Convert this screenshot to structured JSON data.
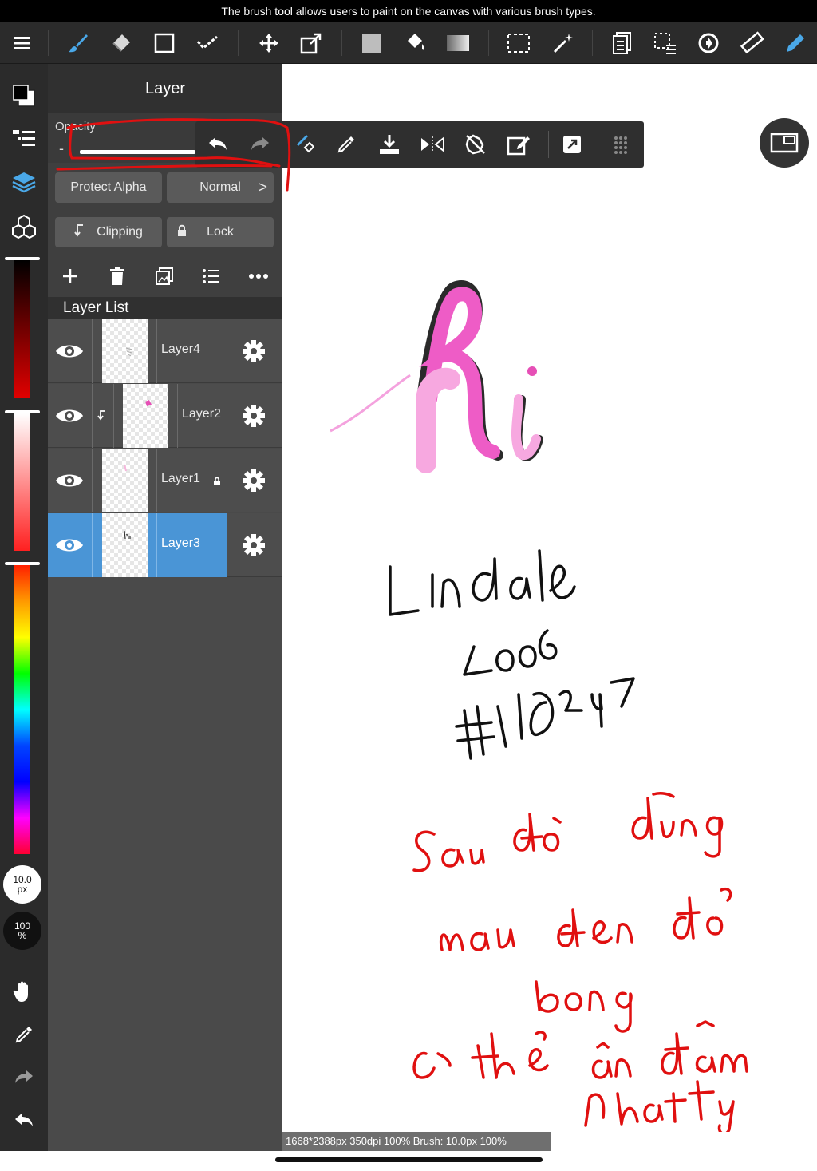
{
  "caption": "The brush tool allows users to paint on the canvas with various brush types.",
  "colors": {
    "accent": "#4a95d6",
    "toolbar_bg": "#2b2b2b",
    "panel_bg": "#4a4a4a",
    "annotation_red": "#e01010"
  },
  "toolbar": {
    "icons": [
      "menu-icon",
      "brush-icon",
      "eraser-icon",
      "rectangle-select-icon",
      "checkmark-icon",
      "move-icon",
      "transform-icon",
      "fill-rect-icon",
      "bucket-icon",
      "gradient-icon",
      "selection-icon",
      "magic-wand-icon",
      "layers-copy-icon",
      "select-layer-icon",
      "rotate-icon",
      "ruler-icon",
      "pen-icon"
    ]
  },
  "panel": {
    "title": "Layer",
    "opacity_label": "Opacity",
    "opacity_minus": "-",
    "protect_alpha": "Protect Alpha",
    "blend_mode": "Normal",
    "blend_chevron": ">",
    "clipping": "Clipping",
    "lock": "Lock",
    "layer_list_title": "Layer List",
    "layers": [
      {
        "name": "Layer4",
        "selected": false,
        "clipped": false,
        "locked": false
      },
      {
        "name": "Layer2",
        "selected": false,
        "clipped": true,
        "locked": false
      },
      {
        "name": "Layer1",
        "selected": false,
        "clipped": false,
        "locked": true
      },
      {
        "name": "Layer3",
        "selected": true,
        "clipped": false,
        "locked": false
      }
    ]
  },
  "leftstrip": {
    "brush_size_value": "10.0",
    "brush_size_unit": "px",
    "opacity_value": "100",
    "opacity_unit": "%"
  },
  "statusbar": "1668*2388px 350dpi 100% Brush: 10.0px 100%"
}
